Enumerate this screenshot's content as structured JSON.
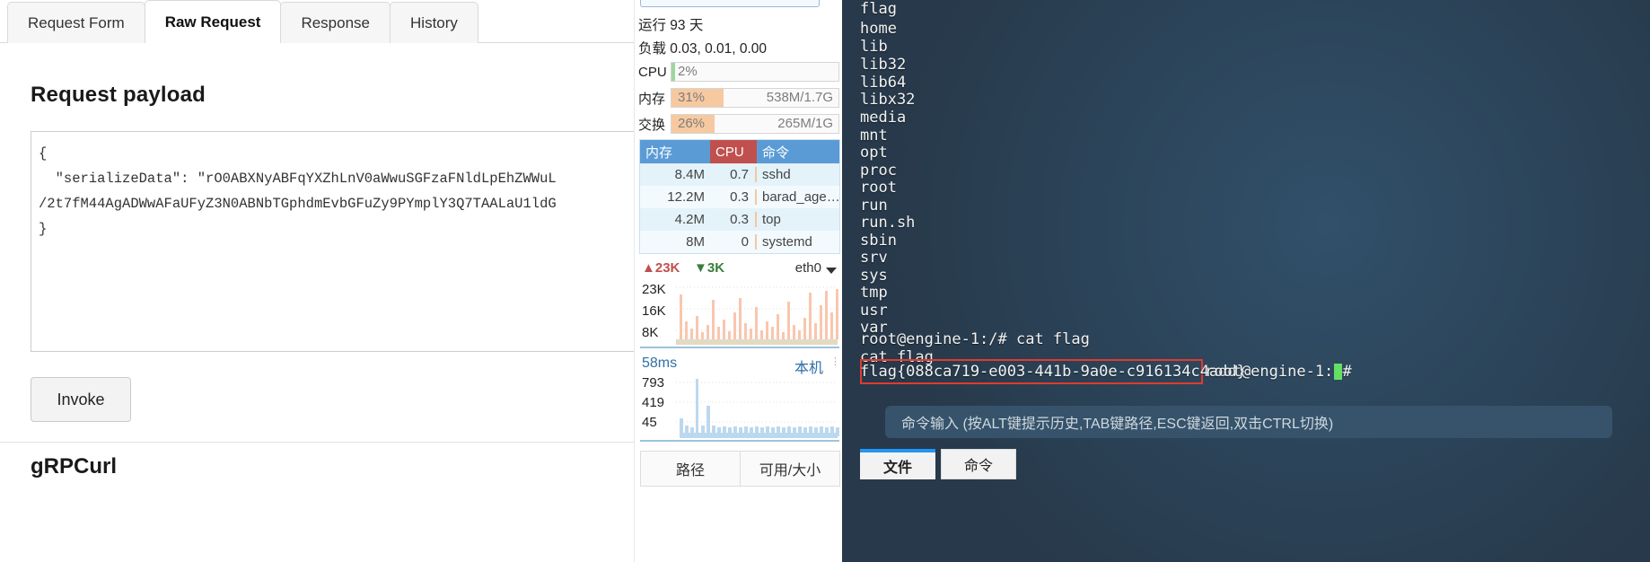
{
  "grpc": {
    "tabs": [
      {
        "label": "Request Form",
        "active": false
      },
      {
        "label": "Raw Request",
        "active": true
      },
      {
        "label": "Response",
        "active": false
      },
      {
        "label": "History",
        "active": false
      }
    ],
    "payload_title": "Request payload",
    "payload_lines": [
      "{",
      "  \"serializeData\": \"rO0ABXNyABFqYXZhLnV0aWwuSGFzaFNldLpEhZWWuL",
      "/2t7fM44AgADWwAFaUFyZ3N0ABNbTGphdmEvbGFuZy9PYmplY3Q7TAALaU1ldG",
      "}"
    ],
    "invoke_label": "Invoke",
    "grpcurl_title": "gRPCurl"
  },
  "monitor": {
    "uptime": "运行 93 天",
    "load": "负载 0.03, 0.01, 0.00",
    "gauges": [
      {
        "label": "CPU",
        "pct": "2%",
        "value": "",
        "fill": 2,
        "color": "#9fd69f"
      },
      {
        "label": "内存",
        "pct": "31%",
        "value": "538M/1.7G",
        "fill": 31,
        "color": "#f7c9a0"
      },
      {
        "label": "交换",
        "pct": "26%",
        "value": "265M/1G",
        "fill": 26,
        "color": "#f7c9a0"
      }
    ],
    "process_table": {
      "headers": [
        "内存",
        "CPU",
        "命令"
      ],
      "rows": [
        {
          "mem": "8.4M",
          "cpu": "0.7",
          "cmd": "sshd"
        },
        {
          "mem": "12.2M",
          "cpu": "0.3",
          "cmd": "barad_age…"
        },
        {
          "mem": "4.2M",
          "cpu": "0.3",
          "cmd": "top"
        },
        {
          "mem": "8M",
          "cpu": "0",
          "cmd": "systemd"
        }
      ]
    },
    "network": {
      "up": "23K",
      "down": "3K",
      "interface": "eth0",
      "y_labels": [
        "23K",
        "16K",
        "8K"
      ]
    },
    "latency": {
      "value": "58ms",
      "host": "本机",
      "y_labels": [
        "793",
        "419",
        "45"
      ]
    },
    "bottom_tabs": [
      "路径",
      "可用/大小"
    ],
    "colors": {
      "header_blue": "#5b9bd5",
      "header_red": "#c0504d",
      "orange": "#f7c9a0",
      "green": "#9fd69f"
    }
  },
  "terminal": {
    "listing": [
      "flag",
      "home",
      "lib",
      "lib32",
      "lib64",
      "libx32",
      "media",
      "mnt",
      "opt",
      "proc",
      "root",
      "run",
      "run.sh",
      "sbin",
      "srv",
      "sys",
      "tmp",
      "usr",
      "var"
    ],
    "prompt_line": "root@engine-1:/# cat flag",
    "echo_line": "cat flag",
    "flag_text": "flag{088ca719-e003-441b-9a0e-c916134c4add}",
    "trailing_prompt": "root@engine-1:/# ",
    "hint": "命令输入 (按ALT键提示历史,TAB键路径,ESC键返回,双击CTRL切换)",
    "tabs": [
      "文件",
      "命令"
    ],
    "highlight_color": "#e03b2f",
    "cursor_color": "#64e064"
  }
}
